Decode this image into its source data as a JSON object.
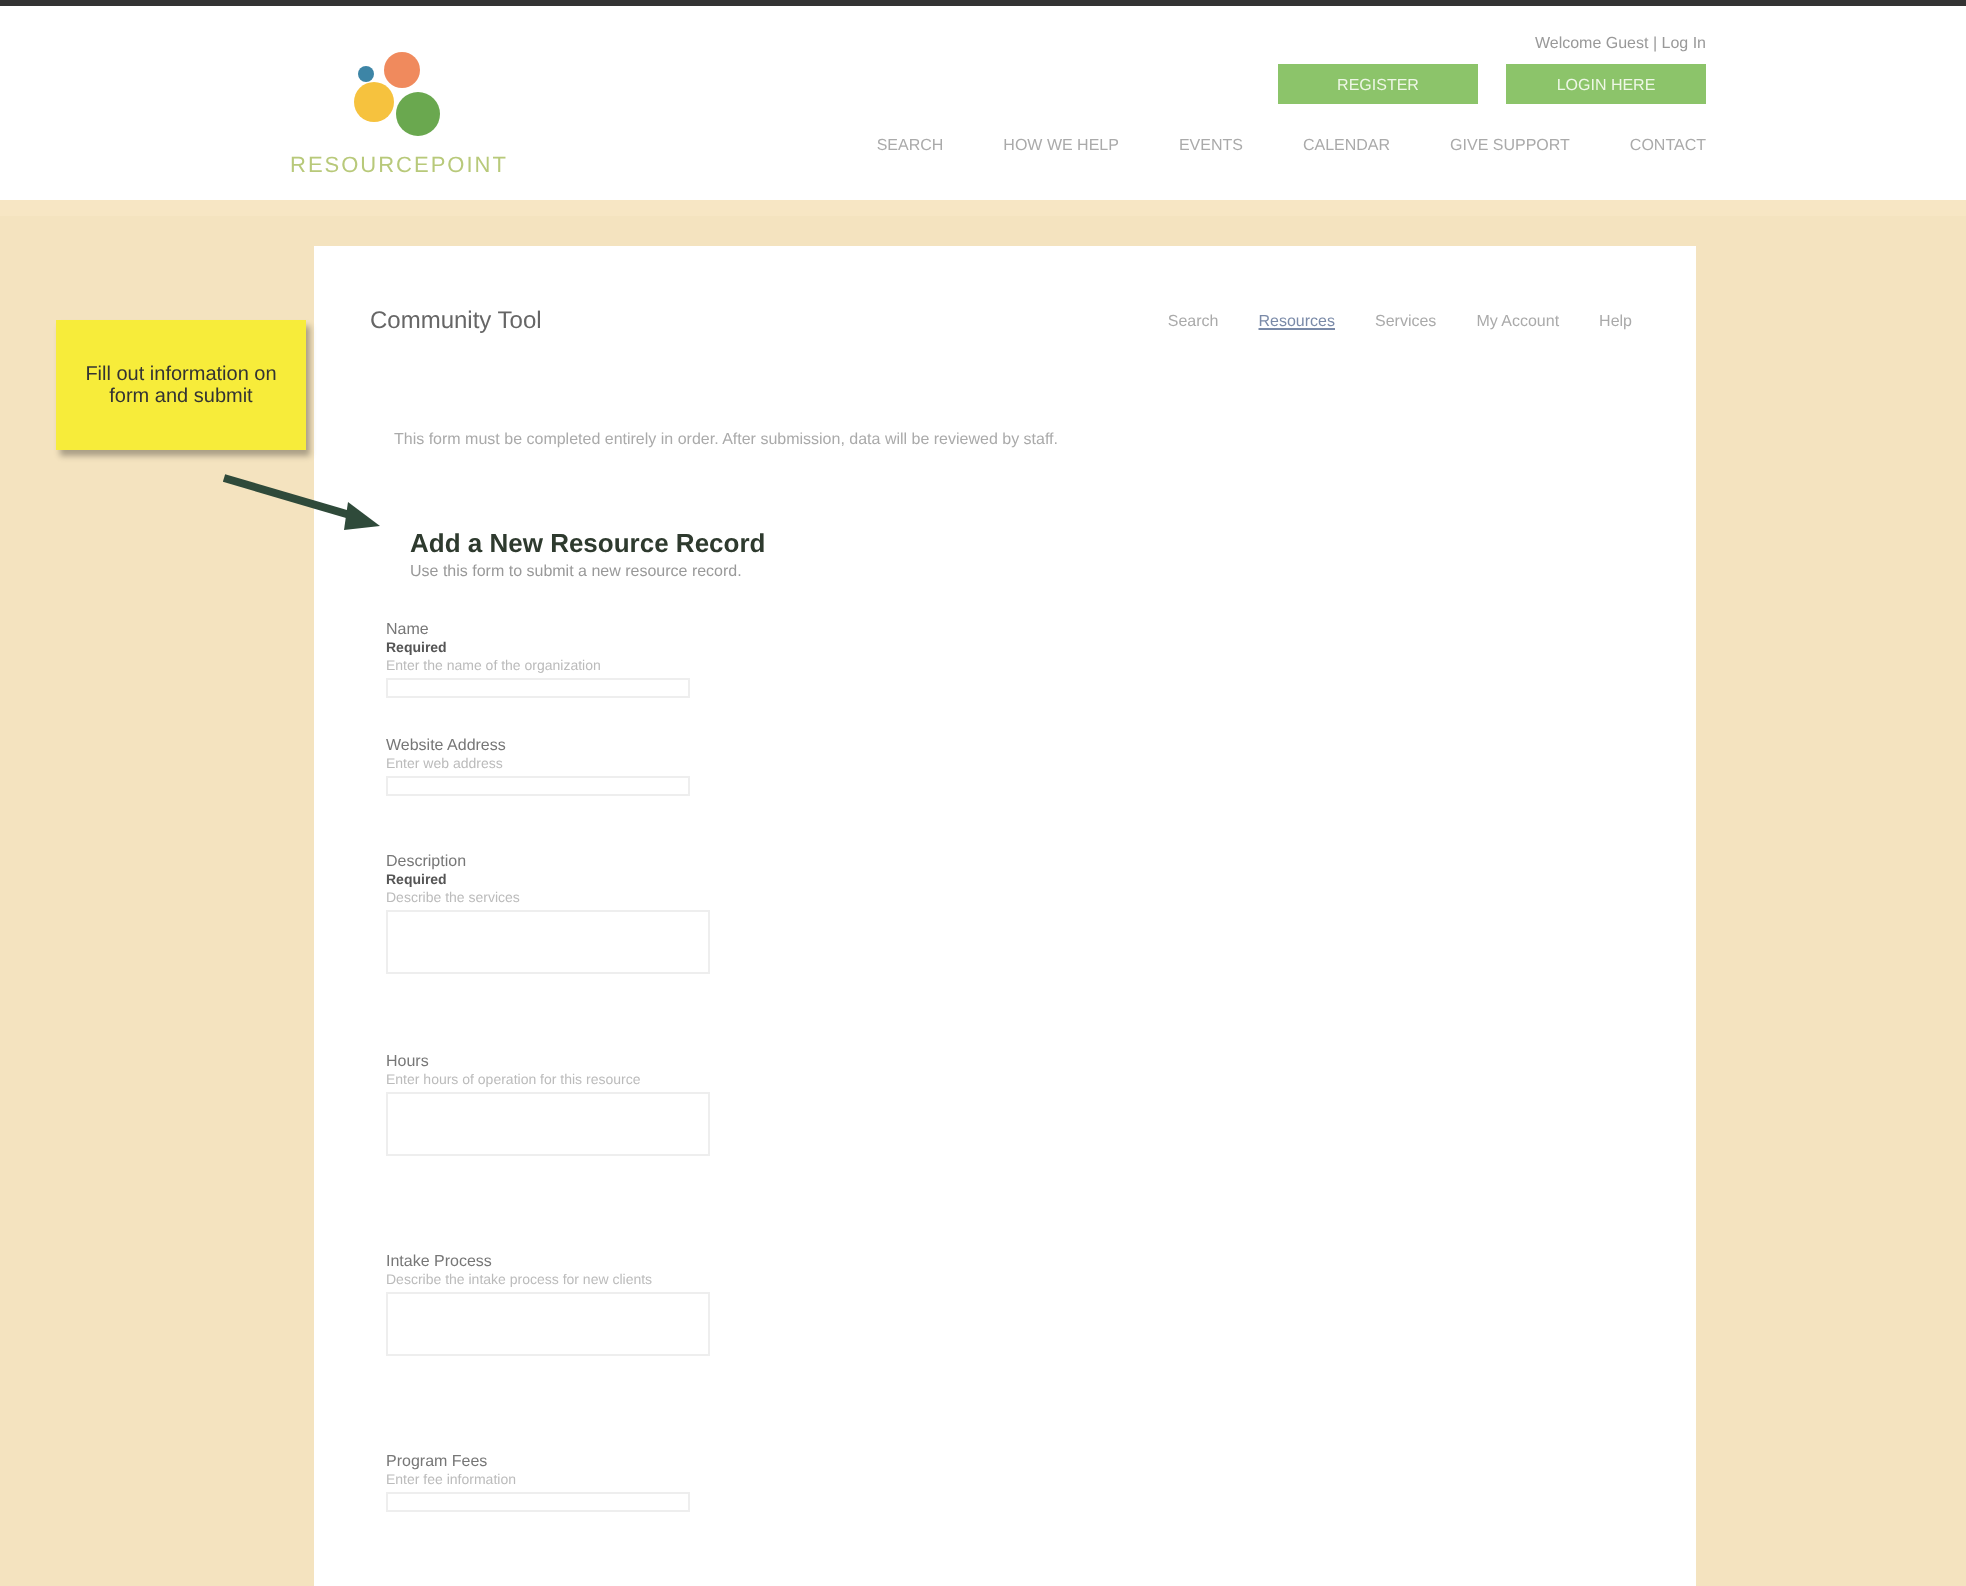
{
  "header": {
    "logo_text": "RESOURCEPOINT",
    "user_links": "Welcome Guest | Log In",
    "buttons": [
      "REGISTER",
      "LOGIN HERE"
    ],
    "nav": [
      "SEARCH",
      "HOW WE HELP",
      "EVENTS",
      "CALENDAR",
      "GIVE SUPPORT",
      "CONTACT"
    ]
  },
  "note": {
    "text": "Fill out information on form and submit"
  },
  "tool": {
    "title": "Community Tool",
    "tabs": [
      {
        "label": "Search",
        "selected": false
      },
      {
        "label": "Resources",
        "selected": true
      },
      {
        "label": "Services",
        "selected": false
      },
      {
        "label": "My Account",
        "selected": false
      },
      {
        "label": "Help",
        "selected": false
      }
    ]
  },
  "intro": "This form must be completed entirely in order. After submission, data will be reviewed by staff.",
  "form": {
    "title": "Add a New Resource Record",
    "subtitle": "Use this form to submit a new resource record.",
    "fields": [
      {
        "label": "Name",
        "note": "Required",
        "help": "Enter the name of the organization",
        "kind": "line"
      },
      {
        "label": "Website Address",
        "help": "Enter web address",
        "kind": "line"
      },
      {
        "label": "Description",
        "note": "Required",
        "help": "Describe the services",
        "kind": "area"
      },
      {
        "label": "Hours",
        "help": "Enter hours of operation for this resource",
        "kind": "area"
      },
      {
        "label": "Intake Process",
        "help": "Describe the intake process for new clients",
        "kind": "area"
      },
      {
        "label": "Program Fees",
        "help": "Enter fee information",
        "kind": "line"
      }
    ]
  }
}
